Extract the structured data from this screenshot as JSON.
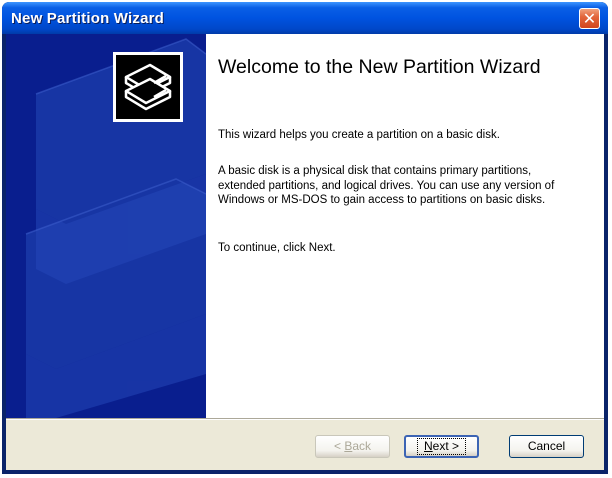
{
  "window": {
    "title": "New Partition Wizard"
  },
  "wizard": {
    "heading": "Welcome to the New Partition Wizard",
    "paragraphs": [
      "This wizard helps you create a partition on a basic disk.",
      "A basic disk is a physical disk that contains primary partitions, extended partitions, and logical drives. You can use any version of Windows or MS-DOS to gain access to partitions on basic disks.",
      "To continue, click Next."
    ]
  },
  "buttons": {
    "back": {
      "prefix": "< ",
      "accel": "B",
      "rest": "ack"
    },
    "next": {
      "accel": "N",
      "rest": "ext >"
    },
    "cancel": "Cancel"
  },
  "colors": {
    "titlebar": "#0053e0",
    "side_panel": "#091e8e",
    "dialog_bg": "#ece9d8"
  }
}
